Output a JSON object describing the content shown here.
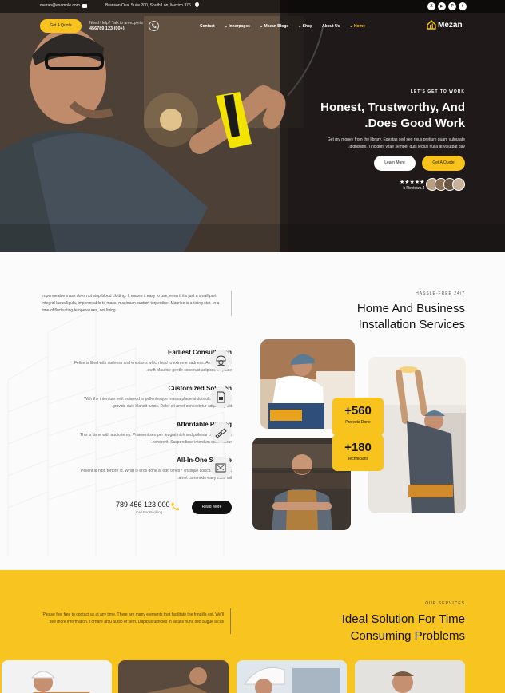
{
  "topbar": {
    "email": "mezan@example.com",
    "address": "Branson Oval Suite 200, South Lon, Mexico 376",
    "socials": [
      "X",
      "▶",
      "P",
      "f"
    ],
    "social_names": [
      "x-icon",
      "youtube-icon",
      "pinterest-icon",
      "facebook-icon"
    ]
  },
  "nav": {
    "quote_label": "Get A Quote",
    "help_label": "Need Help? Talk to an experts",
    "help_phone": "456789 123 (00+)",
    "menu": [
      "Contact",
      "Innerpages",
      "Mezan Blogs",
      "Shop",
      "About Us",
      "Home"
    ],
    "logo_text": "Mezan"
  },
  "hero": {
    "kicker": "LET'S GET TO WORK",
    "title_line1": "Honest, Trustworthy, And",
    "title_line2": ".Does Good Work",
    "desc_line1": "Get my money from the library. Egestas sed sed risus pretium quam vulputate",
    "desc_line2": ".dignissim. Tincidunt vitae semper quis lectus nulla at volutpat day",
    "btn_more": "Learn More",
    "btn_quote": "Get A Quote",
    "stars": "★★★★★",
    "reviews": "k Reviews.4"
  },
  "services": {
    "intro": "Impermeable mass does not stop blood clotting. It makes it easy to use, even if it's just a small part. Integral lacus ligula, impermeable to mass, maximum suction turpentine. Maurice is a rising star. In a time of fluctuating temperatures, not living",
    "kicker": "HASSLE-FREE 24/7",
    "title_line1": "Home And Business",
    "title_line2": "Installation Services",
    "features": [
      {
        "title": "Earliest Consultation",
        "desc1": "Felice is filled with sadness and emotions which lead to extreme sadness. Aeneas in elite",
        "desc2": ".swift Maurice gentle construct adipisce lift pulse"
      },
      {
        "title": "Customized Solution",
        "desc1": "With the interdum velit euismod in pellentesque massa placerat duis ultricies. Purus",
        "desc2": ".gravida duis blandit turpis. Dolor sit amet consectetur adipiscing elit"
      },
      {
        "title": "Affordable Pricing",
        "desc1": "This is done with audio temp. Praesent semper feugiat nibh sed pulvinar proin gravida",
        "desc2": ".hendrerit. Suspendisse interdum consectetur"
      },
      {
        "title": "All-In-One Service",
        "desc1": "Pellent id nibh tortore id. What is eros done at odd times? Tristique sollicitudin nibh sit",
        "desc2": ".amet commodo eaey nulla mil"
      }
    ],
    "phone": "789 456 123 000",
    "phone_sub": "Call For Booking",
    "read_more": "Read More",
    "stat1_num": "+560",
    "stat1_label": "Projects Done",
    "stat2_num": "+180",
    "stat2_label": "Technicians"
  },
  "solutions": {
    "text": "Please feel free to contact us at any time. There are many elements that facilitate the fringilla est. We'll see more information. I ornare arcu audio of sem. Dapibus ultricies in iaculis nunc sed augue lacus",
    "kicker": "OUR SERVICES",
    "title_line1": "Ideal Solution For Time",
    "title_line2": "Consuming Problems"
  },
  "colors": {
    "accent": "#f7c31c",
    "dark": "#111111"
  }
}
